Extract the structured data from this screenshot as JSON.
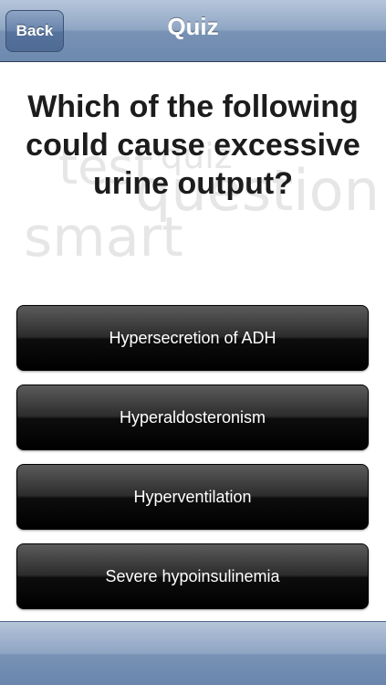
{
  "navbar": {
    "back_label": "Back",
    "title": "Quiz"
  },
  "watermark": {
    "words": [
      "test",
      "quiz",
      "question",
      "smart"
    ]
  },
  "question": {
    "text": "Which of the following could cause excessive urine output?"
  },
  "answers": [
    {
      "label": "Hypersecretion of ADH"
    },
    {
      "label": "Hyperaldosteronism"
    },
    {
      "label": "Hyperventilation"
    },
    {
      "label": "Severe hypoinsulinemia"
    }
  ],
  "colors": {
    "navbar": "#8fa6c4",
    "answer_button": "#1a1a1a",
    "question_text": "#1c1c1c"
  }
}
